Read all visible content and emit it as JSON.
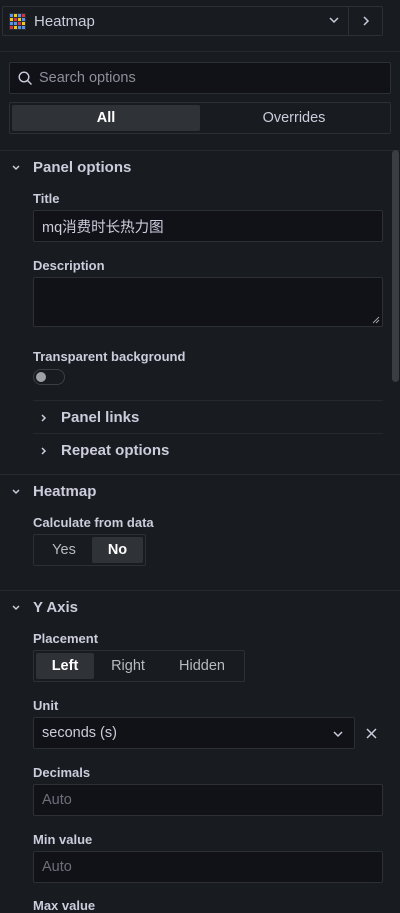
{
  "header": {
    "viz_name": "Heatmap"
  },
  "search": {
    "placeholder": "Search options"
  },
  "tabs": [
    {
      "label": "All",
      "active": true
    },
    {
      "label": "Overrides",
      "active": false
    }
  ],
  "panel_options": {
    "section_label": "Panel options",
    "title_label": "Title",
    "title_value": "mq消费时长热力图",
    "description_label": "Description",
    "description_value": "",
    "transparent_label": "Transparent background",
    "transparent_on": false,
    "panel_links_label": "Panel links",
    "repeat_options_label": "Repeat options"
  },
  "heatmap": {
    "section_label": "Heatmap",
    "calc_label": "Calculate from data",
    "calc_options": [
      "Yes",
      "No"
    ],
    "calc_selected": "No"
  },
  "y_axis": {
    "section_label": "Y Axis",
    "placement_label": "Placement",
    "placement_options": [
      "Left",
      "Right",
      "Hidden"
    ],
    "placement_selected": "Left",
    "unit_label": "Unit",
    "unit_value": "seconds (s)",
    "decimals_label": "Decimals",
    "decimals_placeholder": "Auto",
    "min_label": "Min value",
    "min_placeholder": "Auto",
    "max_label": "Max value"
  },
  "colors": {
    "bg": "#181b1f",
    "input_bg": "#111217",
    "border": "#2c3035",
    "active_seg": "#2f3237",
    "text": "#ccccdc"
  }
}
